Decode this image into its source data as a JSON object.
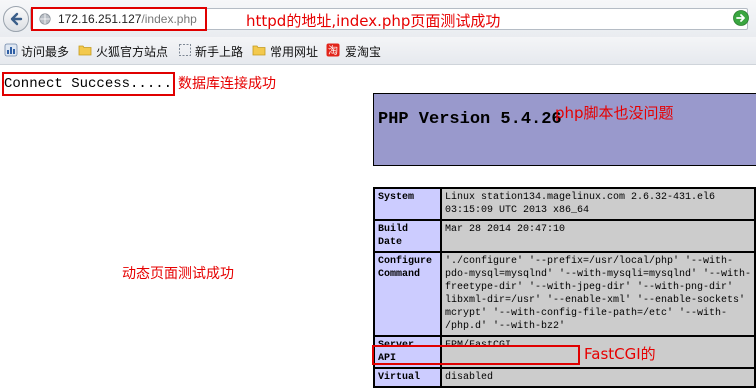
{
  "address_bar": {
    "host": "172.16.251.127",
    "path": "/index.php",
    "annotation": "httpd的地址,index.php页面测试成功"
  },
  "bookmarks": [
    {
      "label": "访问最多",
      "icon": "most-visited-icon"
    },
    {
      "label": "火狐官方站点",
      "icon": "folder-icon"
    },
    {
      "label": "新手上路",
      "icon": "dotted-page-icon"
    },
    {
      "label": "常用网址",
      "icon": "folder-icon"
    },
    {
      "label": "爱淘宝",
      "icon": "taobao-icon"
    }
  ],
  "page": {
    "connect_text": "Connect Success.....",
    "annotation_db": "数据库连接成功",
    "annotation_dynamic": "动态页面测试成功",
    "annotation_php": "php脚本也没问题",
    "annotation_fastcgi": "FastCGI的"
  },
  "phpinfo": {
    "title": "PHP Version 5.4.26",
    "rows": [
      {
        "key": "System",
        "value_lines": [
          "Linux station134.magelinux.com 2.6.32-431.el6",
          "03:15:09 UTC 2013 x86_64"
        ]
      },
      {
        "key": "Build Date",
        "value_lines": [
          "Mar 28 2014 20:47:10"
        ]
      },
      {
        "key": "Configure Command",
        "value_lines": [
          "'./configure' '--prefix=/usr/local/php' '--with-",
          "pdo-mysql=mysqlnd' '--with-mysqli=mysqlnd' '--with-",
          "freetype-dir' '--with-jpeg-dir' '--with-png-dir'",
          "libxml-dir=/usr' '--enable-xml' '--enable-sockets'",
          "mcrypt' '--with-config-file-path=/etc' '--with-",
          "/php.d' '--with-bz2'"
        ]
      },
      {
        "key": "Server API",
        "value_lines": [
          "FPM/FastCGI"
        ]
      },
      {
        "key": "Virtual",
        "value_lines": [
          "disabled"
        ]
      }
    ]
  },
  "colors": {
    "annotation_red": "#e60000",
    "php_header_bg": "#9999cc",
    "php_key_bg": "#ccccff",
    "php_value_bg": "#cccccc"
  }
}
